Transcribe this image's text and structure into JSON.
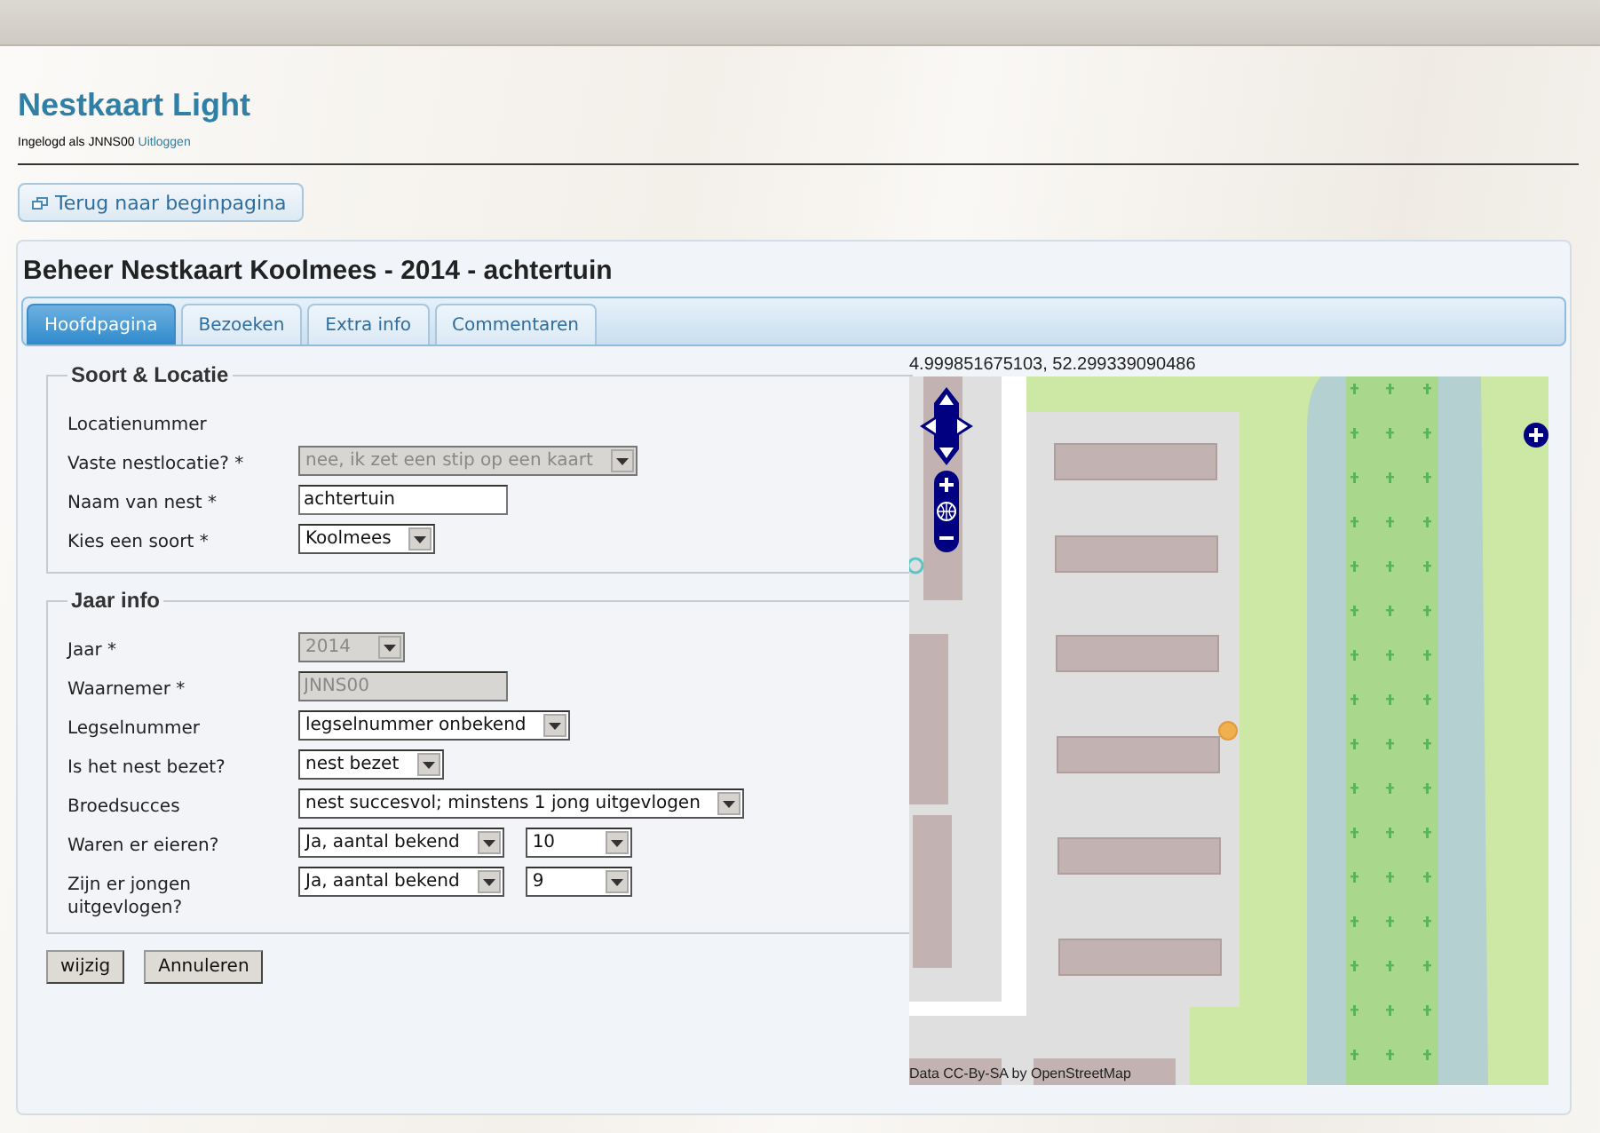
{
  "app": {
    "title": "Nestkaart Light",
    "login_text": "Ingelogd als JNNS00",
    "logout_link": "Uitloggen"
  },
  "back_button": {
    "label": "Terug naar beginpagina"
  },
  "page_title": "Beheer Nestkaart Koolmees - 2014 - achtertuin",
  "tabs": [
    {
      "label": "Hoofdpagina",
      "selected": true
    },
    {
      "label": "Bezoeken",
      "selected": false
    },
    {
      "label": "Extra info",
      "selected": false
    },
    {
      "label": "Commentaren",
      "selected": false
    }
  ],
  "fieldsets": [
    {
      "legend": "Soort & Locatie",
      "rows": [
        {
          "label": "Locatienummer",
          "controls": []
        },
        {
          "label": "Vaste nestlocatie? *",
          "controls": [
            {
              "kind": "select",
              "value": "nee, ik zet een stip op een kaart",
              "disabled": true
            }
          ]
        },
        {
          "label": "Naam van nest *",
          "controls": [
            {
              "kind": "text",
              "value": "achtertuin",
              "disabled": false
            }
          ]
        },
        {
          "label": "Kies een soort *",
          "controls": [
            {
              "kind": "select",
              "value": "Koolmees",
              "disabled": false
            }
          ]
        }
      ]
    },
    {
      "legend": "Jaar info",
      "rows": [
        {
          "label": "Jaar *",
          "controls": [
            {
              "kind": "select",
              "value": "2014",
              "disabled": true
            }
          ]
        },
        {
          "label": "Waarnemer *",
          "controls": [
            {
              "kind": "text",
              "value": "JNNS00",
              "disabled": true
            }
          ]
        },
        {
          "label": "Legselnummer",
          "controls": [
            {
              "kind": "select",
              "value": "legselnummer onbekend",
              "disabled": false
            }
          ]
        },
        {
          "label": "Is het nest bezet?",
          "controls": [
            {
              "kind": "select",
              "value": "nest bezet",
              "disabled": false
            }
          ]
        },
        {
          "label": "Broedsucces",
          "controls": [
            {
              "kind": "select",
              "value": "nest succesvol; minstens 1 jong uitgevlogen",
              "disabled": false
            }
          ]
        },
        {
          "label": "Waren er eieren?",
          "controls": [
            {
              "kind": "select",
              "value": "Ja, aantal bekend",
              "disabled": false
            },
            {
              "kind": "select",
              "value": "10",
              "disabled": false
            }
          ]
        },
        {
          "label": "Zijn er jongen uitgevlogen?",
          "controls": [
            {
              "kind": "select",
              "value": "Ja, aantal bekend",
              "disabled": false
            },
            {
              "kind": "select",
              "value": "9",
              "disabled": false
            }
          ]
        }
      ]
    }
  ],
  "buttons": [
    "wijzig",
    "Annuleren"
  ],
  "map": {
    "coordinates": "4.999851675103, 52.299339090486",
    "attribution": "Data CC-By-SA by OpenStreetMap"
  }
}
